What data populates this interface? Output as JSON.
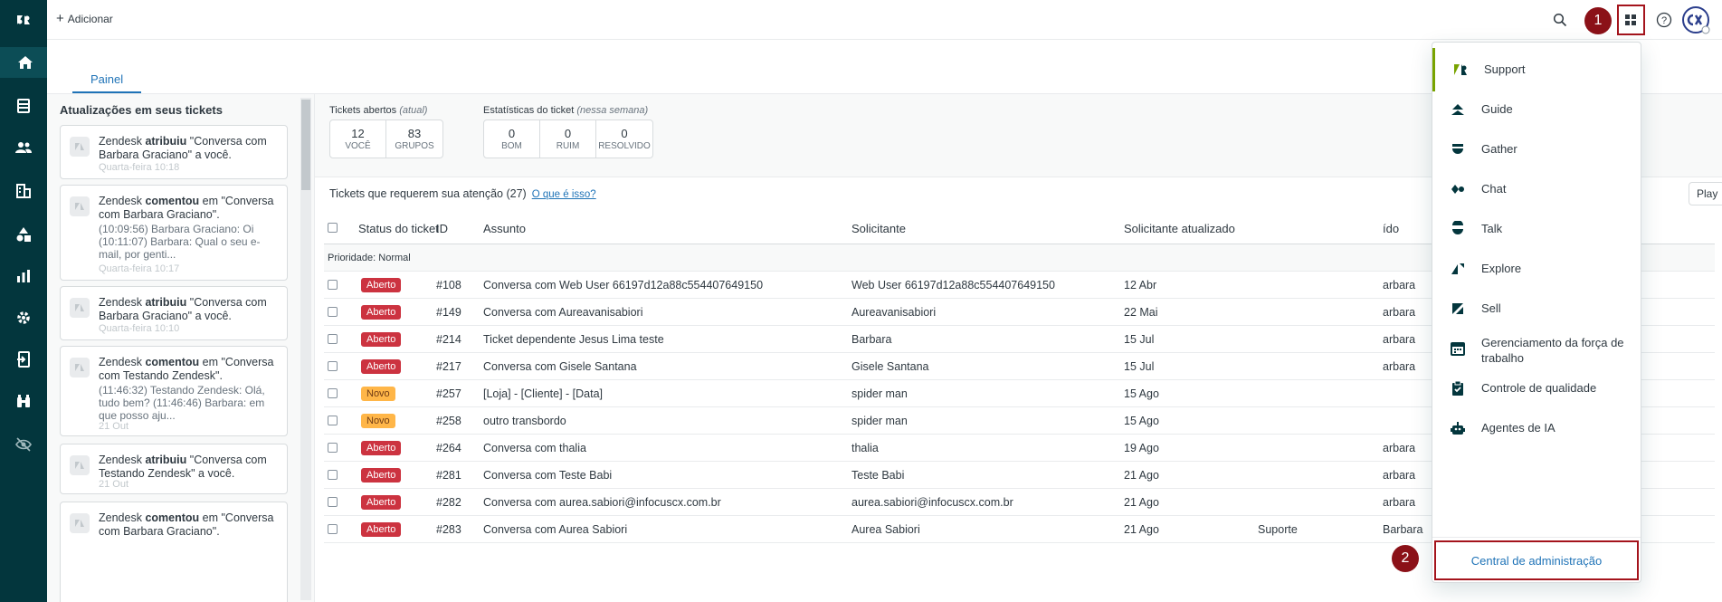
{
  "topbar": {
    "add_label": "Adicionar"
  },
  "badges": {
    "one": "1",
    "two": "2"
  },
  "tabs": {
    "dashboard": "Painel"
  },
  "left": {
    "title": "Atualizações em seus tickets",
    "cards": [
      {
        "actor": "Zendesk",
        "action": "atribuiu",
        "rest": "\"Conversa com Barbara Graciano\" a você.",
        "message": "",
        "time": "Quarta-feira 10:18"
      },
      {
        "actor": "Zendesk",
        "action": "comentou",
        "rest": "em \"Conversa com Barbara Graciano\".",
        "message": "(10:09:56) Barbara Graciano: Oi (10:11:07) Barbara: Qual o seu e-mail, por genti...",
        "time": "Quarta-feira 10:17"
      },
      {
        "actor": "Zendesk",
        "action": "atribuiu",
        "rest": "\"Conversa com Barbara Graciano\" a você.",
        "message": "",
        "time": "Quarta-feira 10:10"
      },
      {
        "actor": "Zendesk",
        "action": "comentou",
        "rest": "em \"Conversa com Testando Zendesk\".",
        "message": "(11:46:32) Testando Zendesk: Olá, tudo bem? (11:46:46) Barbara: em que posso aju...",
        "time": "21 Out"
      },
      {
        "actor": "Zendesk",
        "action": "atribuiu",
        "rest": "\"Conversa com Testando Zendesk\" a você.",
        "message": "",
        "time": "21 Out"
      },
      {
        "actor": "Zendesk",
        "action": "comentou",
        "rest": "em \"Conversa com Barbara Graciano\".",
        "message": "",
        "time": ""
      }
    ]
  },
  "stats": {
    "open_label": "Tickets abertos",
    "open_note": "(atual)",
    "open": [
      {
        "n": "12",
        "l": "VOCÊ"
      },
      {
        "n": "83",
        "l": "GRUPOS"
      }
    ],
    "ticket_label": "Estatísticas do ticket",
    "ticket_note": "(nessa semana)",
    "ticket": [
      {
        "n": "0",
        "l": "BOM"
      },
      {
        "n": "0",
        "l": "RUIM"
      },
      {
        "n": "0",
        "l": "RESOLVIDO"
      }
    ]
  },
  "view": {
    "title": "Tickets que requerem sua atenção (27)",
    "link": "O que é isso?",
    "play": "Play"
  },
  "table": {
    "headers": {
      "status": "Status do ticket",
      "id": "ID",
      "subject": "Assunto",
      "requester": "Solicitante",
      "updated": "Solicitante atualizado",
      "assignee": "ído"
    },
    "group": "Prioridade: Normal",
    "rows": [
      {
        "status": "Aberto",
        "kind": "open",
        "id": "#108",
        "subject": "Conversa com Web User 66197d12a88c554407649150",
        "requester": "Web User 66197d12a88c554407649150",
        "updated": "12 Abr",
        "group": "",
        "assignee": "arbara"
      },
      {
        "status": "Aberto",
        "kind": "open",
        "id": "#149",
        "subject": "Conversa com Aureavanisabiori",
        "requester": "Aureavanisabiori",
        "updated": "22 Mai",
        "group": "",
        "assignee": "arbara"
      },
      {
        "status": "Aberto",
        "kind": "open",
        "id": "#214",
        "subject": "Ticket dependente Jesus Lima teste",
        "requester": "Barbara",
        "updated": "15 Jul",
        "group": "",
        "assignee": "arbara"
      },
      {
        "status": "Aberto",
        "kind": "open",
        "id": "#217",
        "subject": "Conversa com Gisele Santana",
        "requester": "Gisele Santana",
        "updated": "15 Jul",
        "group": "",
        "assignee": "arbara"
      },
      {
        "status": "Novo",
        "kind": "new",
        "id": "#257",
        "subject": "[Loja] - [Cliente] - [Data]",
        "requester": "spider man",
        "updated": "15 Ago",
        "group": "",
        "assignee": ""
      },
      {
        "status": "Novo",
        "kind": "new",
        "id": "#258",
        "subject": "outro transbordo",
        "requester": "spider man",
        "updated": "15 Ago",
        "group": "",
        "assignee": ""
      },
      {
        "status": "Aberto",
        "kind": "open",
        "id": "#264",
        "subject": "Conversa com thalia",
        "requester": "thalia",
        "updated": "19 Ago",
        "group": "",
        "assignee": "arbara"
      },
      {
        "status": "Aberto",
        "kind": "open",
        "id": "#281",
        "subject": "Conversa com Teste Babi",
        "requester": "Teste Babi",
        "updated": "21 Ago",
        "group": "",
        "assignee": "arbara"
      },
      {
        "status": "Aberto",
        "kind": "open",
        "id": "#282",
        "subject": "Conversa com aurea.sabiori@infocuscx.com.br",
        "requester": "aurea.sabiori@infocuscx.com.br",
        "updated": "21 Ago",
        "group": "",
        "assignee": "arbara"
      },
      {
        "status": "Aberto",
        "kind": "open",
        "id": "#283",
        "subject": "Conversa com Aurea Sabiori",
        "requester": "Aurea Sabiori",
        "updated": "21 Ago",
        "group": "Suporte",
        "assignee": "Barbara"
      }
    ]
  },
  "menu": {
    "items": [
      "Support",
      "Guide",
      "Gather",
      "Chat",
      "Talk",
      "Explore",
      "Sell",
      "Gerenciamento da força de trabalho",
      "Controle de qualidade",
      "Agentes de IA"
    ],
    "admin": "Central de administração"
  },
  "colors": {
    "nav": "#03363d",
    "open": "#cc3340",
    "new": "#ffb648",
    "link": "#1f73b7",
    "highlight": "#a4141c",
    "support": "#78a300"
  }
}
